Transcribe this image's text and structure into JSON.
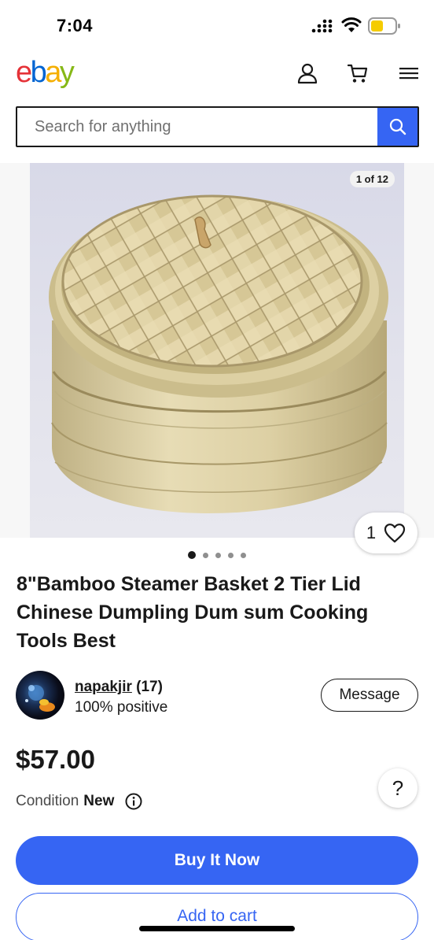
{
  "status_bar": {
    "time": "7:04",
    "icons": [
      "signal-icon",
      "wifi-icon",
      "battery-icon"
    ]
  },
  "header": {
    "logo": {
      "letters": [
        "e",
        "b",
        "a",
        "y"
      ],
      "colors": [
        "#e53238",
        "#0064d2",
        "#f5af02",
        "#86b817"
      ]
    },
    "icons": [
      "user-icon",
      "cart-icon",
      "menu-icon"
    ]
  },
  "search": {
    "placeholder": "Search for anything",
    "value": "",
    "button_icon": "search-icon"
  },
  "gallery": {
    "counter": "1 of 12",
    "favorite_count": "1",
    "favorite_icon": "heart-icon",
    "dots_total": 5,
    "active_dot": 0
  },
  "product": {
    "title": "8\"Bamboo Steamer Basket 2 Tier Lid Chinese Dumpling Dum sum Cooking Tools Best",
    "price": "$57.00",
    "condition_label": "Condition",
    "condition_value": "New"
  },
  "seller": {
    "name": "napakjir",
    "score": "(17)",
    "feedback": "100% positive",
    "message_label": "Message"
  },
  "help": {
    "label": "?"
  },
  "actions": {
    "buy_now": "Buy It Now",
    "add_to_cart": "Add to cart"
  },
  "colors": {
    "accent": "#3665f3",
    "text": "#191919"
  }
}
